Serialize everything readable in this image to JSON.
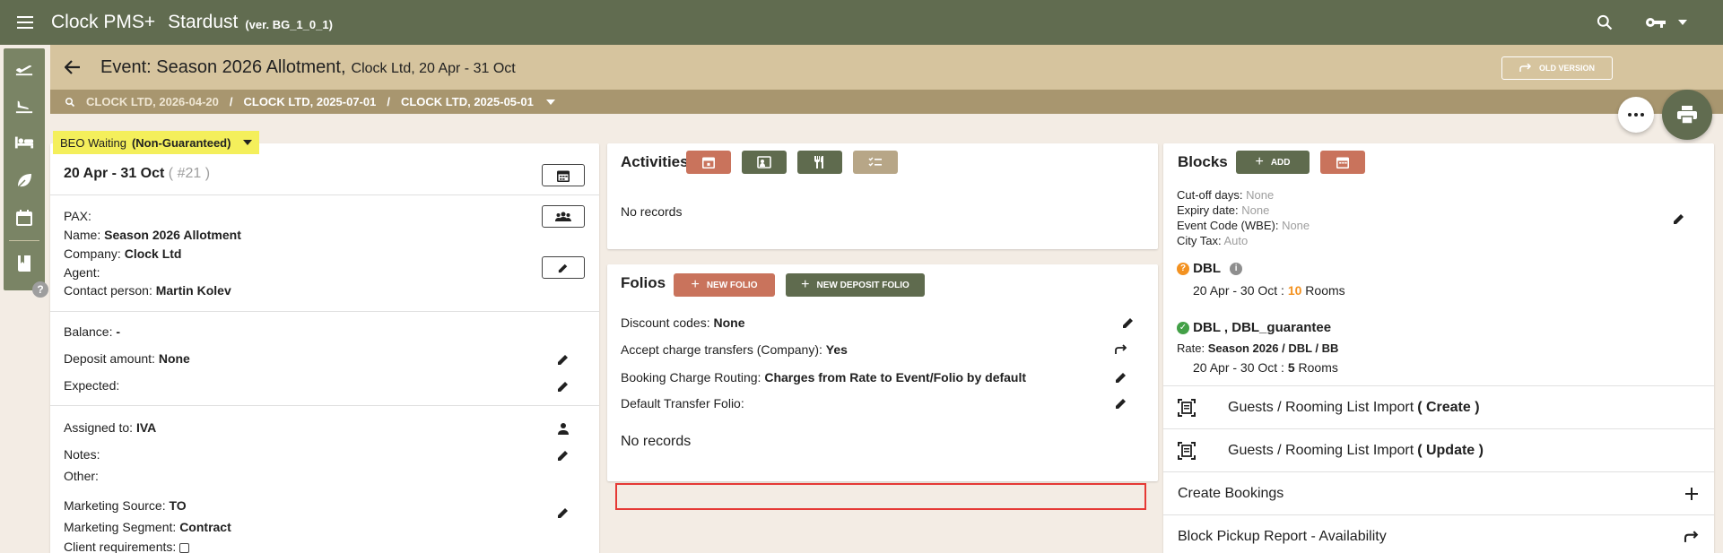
{
  "app": {
    "brand": "Clock PMS+",
    "property": "Stardust",
    "version": "(ver. BG_1_0_1)"
  },
  "header": {
    "event_title": "Event: Season 2026 Allotment,",
    "event_sub": "Clock Ltd, 20 Apr - 31 Oct",
    "old_version_label": "OLD VERSION"
  },
  "breadcrumb": {
    "items": [
      "CLOCK LTD, 2026-04-20",
      "CLOCK LTD, 2025-07-01",
      "CLOCK LTD, 2025-05-01"
    ],
    "separator": "/"
  },
  "status": {
    "label": "BEO Waiting",
    "value": "(Non-Guaranteed)",
    "color": "#f4ef5b"
  },
  "left": {
    "dates": "20 Apr - 31 Oct",
    "number": "( #21 )",
    "pax_label": "PAX:",
    "name_label": "Name:",
    "name_value": "Season 2026 Allotment",
    "company_label": "Company:",
    "company_value": "Clock Ltd",
    "agent_label": "Agent:",
    "contact_label": "Contact person:",
    "contact_value": "Martin Kolev",
    "balance_label": "Balance:",
    "balance_value": "-",
    "deposit_label": "Deposit amount:",
    "deposit_value": "None",
    "expected_label": "Expected:",
    "assigned_label": "Assigned to:",
    "assigned_value": "IVA",
    "notes_label": "Notes:",
    "other_label": "Other:",
    "msource_label": "Marketing Source:",
    "msource_value": "TO",
    "msegment_label": "Marketing Segment:",
    "msegment_value": "Contract",
    "client_req_label": "Client requirements:"
  },
  "activities": {
    "title": "Activities",
    "empty": "No records"
  },
  "folios": {
    "title": "Folios",
    "new_folio": "NEW FOLIO",
    "new_deposit": "NEW DEPOSIT FOLIO",
    "discount_label": "Discount codes:",
    "discount_value": "None",
    "accept_label": "Accept charge transfers (Company):",
    "accept_value": "Yes",
    "routing_label": "Booking Charge Routing:",
    "routing_value": "Charges from Rate to Event/Folio by default",
    "default_transfer_label": "Default Transfer Folio:",
    "empty": "No records"
  },
  "blocks": {
    "title": "Blocks",
    "add_label": "ADD",
    "cutoff_label": "Cut-off days:",
    "cutoff_value": "None",
    "expiry_label": "Expiry date:",
    "expiry_value": "None",
    "eventcode_label": "Event Code (WBE):",
    "eventcode_value": "None",
    "citytax_label": "City Tax:",
    "citytax_value": "Auto",
    "b1_name": "DBL",
    "b1_dates": "20 Apr - 30 Oct :",
    "b1_rooms": "10",
    "b1_rooms_label": "Rooms",
    "b2_name": "DBL , DBL_guarantee",
    "b2_rate_label": "Rate:",
    "b2_rate_value": "Season 2026 / DBL / BB",
    "b2_dates": "20 Apr - 30 Oct :",
    "b2_rooms": "5",
    "b2_rooms_label": "Rooms",
    "import_label": "Guests / Rooming List Import",
    "import_create": "( Create )",
    "import_update": "( Update )",
    "create_bookings": "Create Bookings",
    "pickup_report": "Block Pickup Report - Availability"
  },
  "colors": {
    "topbar": "#616c50",
    "eventbar": "#d6c49e",
    "crumbbar": "#a8966f",
    "red_btn": "#c9735c",
    "green_btn": "#5f6b4e",
    "highlight": "#e53935"
  }
}
